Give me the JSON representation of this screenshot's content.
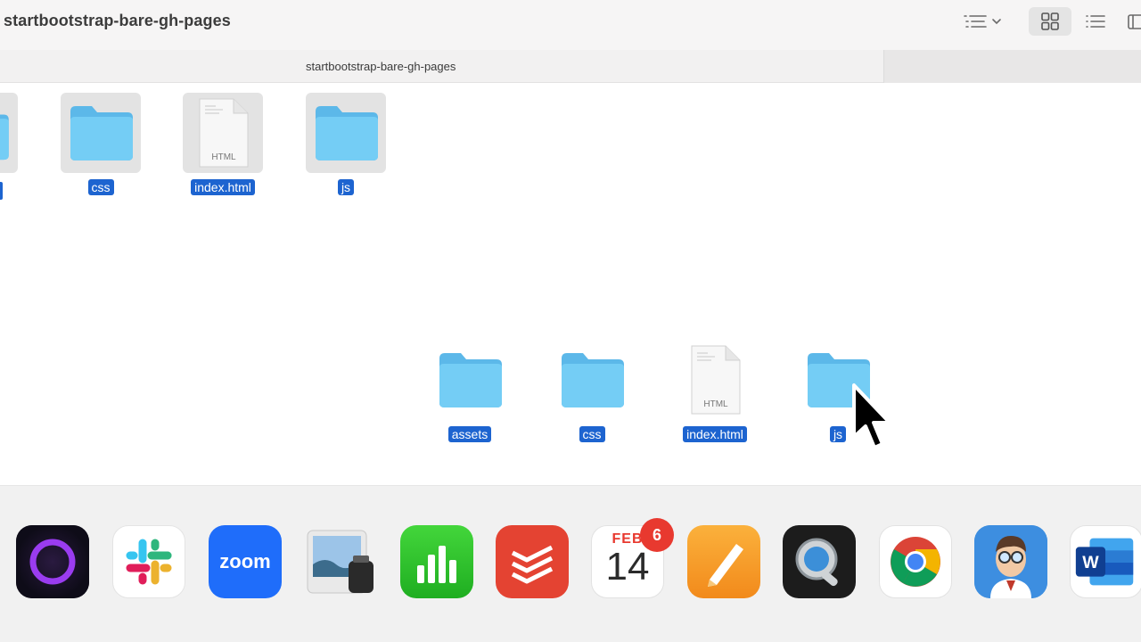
{
  "window": {
    "title": "startbootstrap-bare-gh-pages"
  },
  "tab": {
    "label": "startbootstrap-bare-gh-pages"
  },
  "toolbar": {
    "group_icon": "group-by-icon",
    "view_icon_mode": "icon-view-icon",
    "view_list_mode": "list-view-icon",
    "panel_icon": "sidebar-panel-icon"
  },
  "top_row": [
    {
      "name": "css",
      "type": "folder"
    },
    {
      "name": "index.html",
      "type": "html",
      "badge_text": "HTML"
    },
    {
      "name": "js",
      "type": "folder"
    }
  ],
  "bottom_row": [
    {
      "name": "assets",
      "type": "folder"
    },
    {
      "name": "css",
      "type": "folder"
    },
    {
      "name": "index.html",
      "type": "html",
      "badge_text": "HTML"
    },
    {
      "name": "js",
      "type": "folder"
    }
  ],
  "dock": {
    "apps": [
      "Orion",
      "Slack",
      "Zoom",
      "Preview",
      "Numbers",
      "Todoist",
      "Calendar",
      "Pages",
      "QuickTime Player",
      "Chrome",
      "Doctor",
      "Word"
    ],
    "zoom_text": "zoom",
    "calendar": {
      "month": "FEB",
      "day": "14",
      "badge": "6"
    },
    "word_letter": "W"
  },
  "colors": {
    "selection": "#1d64d0",
    "folder": "#6cc6f2",
    "toolbar_bg": "#f6f5f5"
  }
}
